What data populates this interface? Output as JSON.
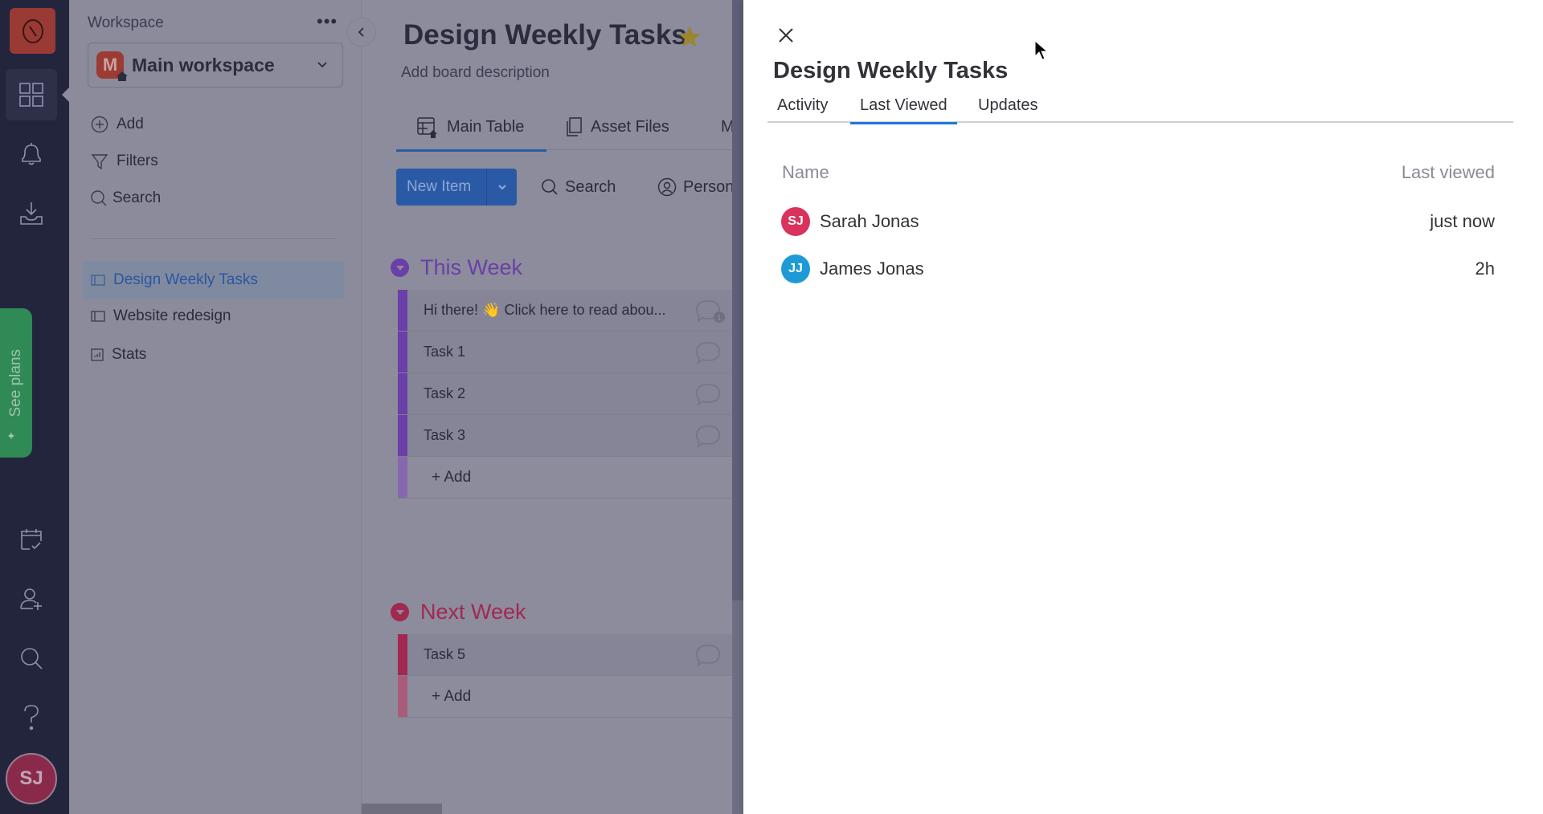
{
  "nav": {
    "items": [
      {
        "icon": "logo-icon"
      },
      {
        "icon": "workspaces-grid-icon"
      },
      {
        "icon": "notifications-bell-icon"
      },
      {
        "icon": "inbox-download-icon"
      },
      {
        "icon": "my-work-calendar-icon"
      },
      {
        "icon": "invite-members-icon"
      },
      {
        "icon": "search-icon"
      },
      {
        "icon": "help-icon"
      }
    ],
    "see_plans": "See plans",
    "user_initials": "SJ"
  },
  "sidebar": {
    "title": "Workspace",
    "more": "•••",
    "workspace": {
      "badge": "M",
      "name": "Main workspace"
    },
    "actions": [
      {
        "label": "Add",
        "icon": "plus-circle-icon"
      },
      {
        "label": "Filters",
        "icon": "filter-icon"
      },
      {
        "label": "Search",
        "icon": "search-icon"
      }
    ],
    "boards": [
      {
        "label": "Design Weekly Tasks",
        "icon": "board-icon",
        "active": true
      },
      {
        "label": "Website redesign",
        "icon": "board-icon",
        "active": false
      },
      {
        "label": "Stats",
        "icon": "dashboard-icon",
        "active": false
      }
    ]
  },
  "board": {
    "title": "Design Weekly Tasks",
    "description": "Add board description",
    "tabs": [
      {
        "label": "Main Table",
        "active": true
      },
      {
        "label": "Asset Files",
        "active": false
      },
      {
        "label": "M",
        "active": false
      }
    ],
    "toolbar": {
      "new_item": "New Item",
      "search": "Search",
      "person": "Person"
    },
    "groups": [
      {
        "title": "This Week",
        "color": "#6a3fa8",
        "items": [
          {
            "name": "Hi there! 👋 Click here to read abou...",
            "updates": "1"
          },
          {
            "name": "Task 1"
          },
          {
            "name": "Task 2"
          },
          {
            "name": "Task 3"
          }
        ],
        "add_label": "+ Add"
      },
      {
        "title": "Next Week",
        "color": "#a3284f",
        "items": [
          {
            "name": "Task 5"
          }
        ],
        "add_label": "+ Add"
      }
    ]
  },
  "panel": {
    "title": "Design Weekly Tasks",
    "tabs": [
      {
        "label": "Activity",
        "active": false
      },
      {
        "label": "Last Viewed",
        "active": true
      },
      {
        "label": "Updates",
        "active": false
      }
    ],
    "columns": {
      "name": "Name",
      "last_viewed": "Last viewed"
    },
    "rows": [
      {
        "initials": "SJ",
        "name": "Sarah Jonas",
        "time": "just now",
        "color": "#d9325c"
      },
      {
        "initials": "JJ",
        "name": "James Jonas",
        "time": "2h",
        "color": "#1f9ad6"
      }
    ]
  }
}
